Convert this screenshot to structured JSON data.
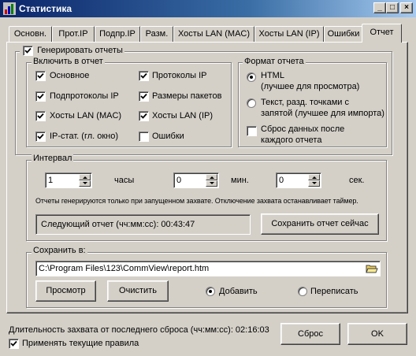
{
  "window": {
    "title": "Статистика",
    "minimize_label": "_",
    "maximize_label": "□",
    "close_label": "×"
  },
  "tabs": [
    {
      "label": "Основн."
    },
    {
      "label": "Прот.IP"
    },
    {
      "label": "Подпр.IP"
    },
    {
      "label": "Разм."
    },
    {
      "label": "Хосты LAN (MAC)"
    },
    {
      "label": "Хосты LAN (IP)"
    },
    {
      "label": "Ошибки"
    },
    {
      "label": "Отчет"
    }
  ],
  "active_tab": "Отчет",
  "report": {
    "generate_label": "Генерировать отчеты",
    "generate_checked": true,
    "include": {
      "title": "Включить в отчет",
      "items": [
        {
          "label": "Основное",
          "checked": true
        },
        {
          "label": "Протоколы IP",
          "checked": true
        },
        {
          "label": "Подпротоколы IP",
          "checked": true
        },
        {
          "label": "Размеры пакетов",
          "checked": true
        },
        {
          "label": "Хосты LAN (MAC)",
          "checked": true
        },
        {
          "label": "Хосты LAN (IP)",
          "checked": true
        },
        {
          "label": "IP-стат. (гл. окно)",
          "checked": true
        },
        {
          "label": "Ошибки",
          "checked": false
        }
      ]
    },
    "format": {
      "title": "Формат отчета",
      "html_line1": "HTML",
      "html_line2": "(лучшее для просмотра)",
      "html_selected": true,
      "csv_line1": "Текст, разд. точками с",
      "csv_line2": "запятой (лучшее для импорта)",
      "csv_selected": false,
      "reset_line1": "Сброс данных после",
      "reset_line2": "каждого отчета",
      "reset_checked": false
    },
    "interval": {
      "title": "Интервал",
      "hours_value": "1",
      "hours_label": "часы",
      "minutes_value": "0",
      "minutes_label": "мин.",
      "seconds_value": "0",
      "seconds_label": "сек.",
      "note": "Отчеты генерируются только при запущенном захвате. Отключение захвата останавливает таймер.",
      "next_report": "Следующий отчет (чч:мм:сс): 00:43:47",
      "save_now_label": "Сохранить отчет сейчас"
    },
    "save": {
      "title": "Сохранить в:",
      "path": "C:\\Program Files\\123\\CommView\\report.htm",
      "browse_label": "Просмотр",
      "clear_label": "Очистить",
      "append_label": "Добавить",
      "append_selected": true,
      "overwrite_label": "Переписать",
      "overwrite_selected": false
    }
  },
  "footer": {
    "duration": "Длительность захвата от последнего сброса (чч:мм:сс): 02:16:03",
    "apply_rules_label": "Применять текущие правила",
    "apply_rules_checked": true,
    "reset_label": "Сброс",
    "ok_label": "OK"
  }
}
